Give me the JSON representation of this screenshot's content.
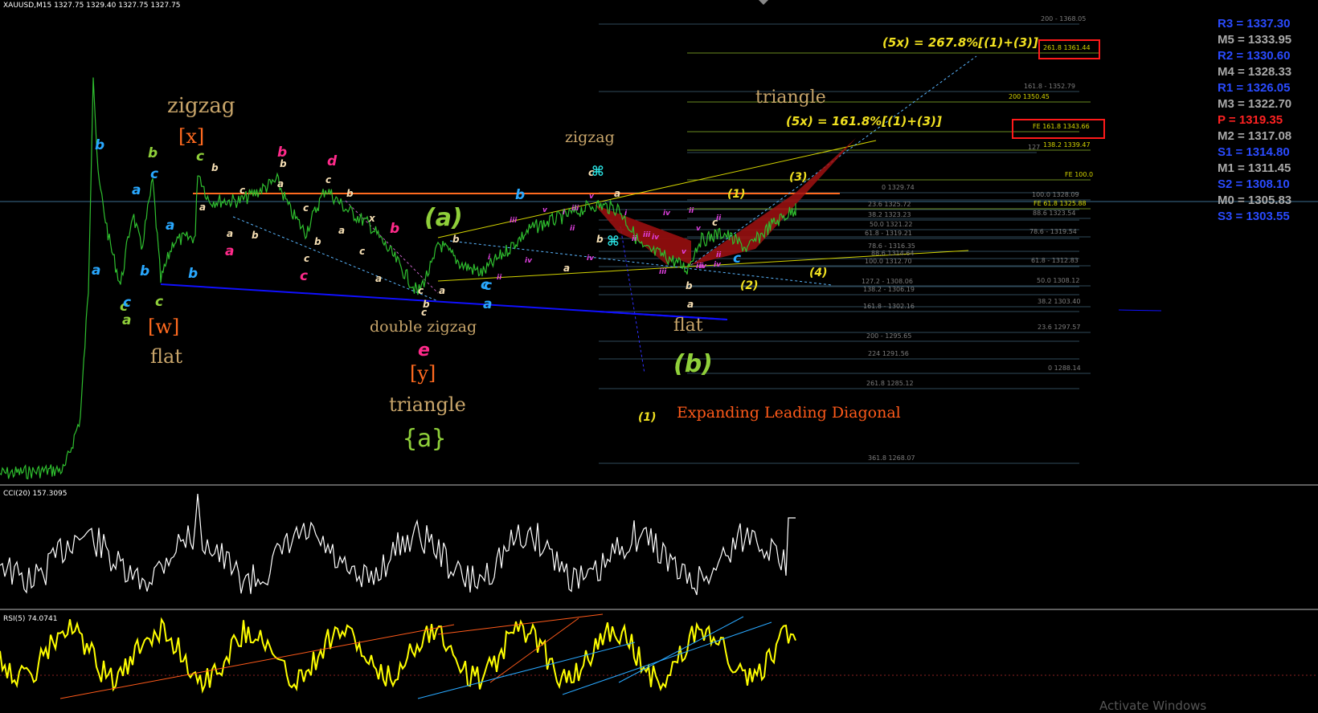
{
  "header": {
    "title": "XAUUSD,M15  1327.75 1329.40 1327.75 1327.75",
    "cci_label": "CCI(20) 157.3095",
    "rsi_label": "RSI(5) 74.0741"
  },
  "pivots": [
    {
      "label": "R3 = 1337.30",
      "color": "#2a4bff"
    },
    {
      "label": "M5 = 1333.95",
      "color": "#a9a9a9"
    },
    {
      "label": "R2 = 1330.60",
      "color": "#2a4bff"
    },
    {
      "label": "M4 = 1328.33",
      "color": "#a9a9a9"
    },
    {
      "label": "R1 = 1326.05",
      "color": "#2a4bff"
    },
    {
      "label": "M3 = 1322.70",
      "color": "#a9a9a9"
    },
    {
      "label": "P  = 1319.35",
      "color": "#ff2222"
    },
    {
      "label": "M2 = 1317.08",
      "color": "#a9a9a9"
    },
    {
      "label": "S1 = 1314.80",
      "color": "#2a4bff"
    },
    {
      "label": "M1 = 1311.45",
      "color": "#a9a9a9"
    },
    {
      "label": "S2 = 1308.10",
      "color": "#2a4bff"
    },
    {
      "label": "M0 = 1305.83",
      "color": "#a9a9a9"
    },
    {
      "label": "S3 = 1303.55",
      "color": "#2a4bff"
    }
  ],
  "fib_levels": [
    {
      "label": "200 - 1368.05",
      "color": "#7d7d7d"
    },
    {
      "label": "261.8 1361.44",
      "color": "#d4d400"
    },
    {
      "label": "161.8 - 1352.79",
      "color": "#7d7d7d"
    },
    {
      "label": "200 1350.45",
      "color": "#d4d400"
    },
    {
      "label": "FE 161.8 1343.66",
      "color": "#d4d400"
    },
    {
      "label": "127",
      "color": "#7d7d7d"
    },
    {
      "label": "138.2 1339.47",
      "color": "#d4d400"
    },
    {
      "label": "FE 100.0",
      "color": "#d4d400"
    },
    {
      "label": "0 1329.74",
      "color": "#7d7d7d"
    },
    {
      "label": "100.0 1328.09",
      "color": "#7d7d7d"
    },
    {
      "label": "23.6 1325.72",
      "color": "#7d7d7d"
    },
    {
      "label": "FE 61.8 1325.88",
      "color": "#d4d400"
    },
    {
      "label": "38.2 1323.23",
      "color": "#7d7d7d"
    },
    {
      "label": "88.6 1323.54",
      "color": "#7d7d7d"
    },
    {
      "label": "50.0 1321.22",
      "color": "#7d7d7d"
    },
    {
      "label": "61.8 - 1319.21",
      "color": "#7d7d7d"
    },
    {
      "label": "78.6 - 1319.54",
      "color": "#7d7d7d"
    },
    {
      "label": "78.6 - 1316.35",
      "color": "#7d7d7d"
    },
    {
      "label": "88.6 1314.64",
      "color": "#7d7d7d"
    },
    {
      "label": "100.0 1312.70",
      "color": "#7d7d7d"
    },
    {
      "label": "61.8 - 1312.83",
      "color": "#7d7d7d"
    },
    {
      "label": "127.2 - 1308.06",
      "color": "#7d7d7d"
    },
    {
      "label": "138.2 - 1306.19",
      "color": "#7d7d7d"
    },
    {
      "label": "50.0 1308.12",
      "color": "#7d7d7d"
    },
    {
      "label": "161.8 - 1302.16",
      "color": "#7d7d7d"
    },
    {
      "label": "38.2 1303.40",
      "color": "#7d7d7d"
    },
    {
      "label": "200 - 1295.65",
      "color": "#7d7d7d"
    },
    {
      "label": "23.6 1297.57",
      "color": "#7d7d7d"
    },
    {
      "label": "224 1291.56",
      "color": "#7d7d7d"
    },
    {
      "label": "0 1288.14",
      "color": "#7d7d7d"
    },
    {
      "label": "261.8 1285.12",
      "color": "#7d7d7d"
    },
    {
      "label": "361.8 1268.07",
      "color": "#7d7d7d"
    }
  ],
  "annotations": [
    {
      "text": "zigzag",
      "color": "#c8a56a"
    },
    {
      "text": "[x]",
      "color": "#ff6a1f"
    },
    {
      "text": "[w]",
      "color": "#ff6a1f"
    },
    {
      "text": "flat",
      "color": "#c8a56a"
    },
    {
      "text": "(a)",
      "color": "#8fcf3a"
    },
    {
      "text": "double zigzag",
      "color": "#c8a56a"
    },
    {
      "text": "e",
      "color": "#ff2a8a"
    },
    {
      "text": "[y]",
      "color": "#ff6a1f"
    },
    {
      "text": "triangle",
      "color": "#c8a56a"
    },
    {
      "text": "{a}",
      "color": "#8fcf3a"
    },
    {
      "text": "zigzag",
      "color": "#c8a56a"
    },
    {
      "text": "triangle",
      "color": "#c8a56a"
    },
    {
      "text": "(5x) = 267.8%[(1)+(3)]",
      "color": "#f0e020"
    },
    {
      "text": "(5x) = 161.8%[(1)+(3)]",
      "color": "#f0e020"
    },
    {
      "text": "flat",
      "color": "#c8a56a"
    },
    {
      "text": "(b)",
      "color": "#8fcf3a"
    },
    {
      "text": "Expanding Leading Diagonal",
      "color": "#ff5a1a"
    },
    {
      "text": "(1)",
      "color": "#f0e020"
    },
    {
      "text": "(2)",
      "color": "#f0e020"
    },
    {
      "text": "(3)",
      "color": "#f0e020"
    },
    {
      "text": "(4)",
      "color": "#f0e020"
    },
    {
      "text": "(1)",
      "color": "#f0e020"
    }
  ],
  "wave_labels": [
    {
      "text": "b",
      "color": "#29a8ff"
    },
    {
      "text": "b",
      "color": "#8fcf3a"
    },
    {
      "text": "c",
      "color": "#29a8ff"
    },
    {
      "text": "a",
      "color": "#29a8ff"
    },
    {
      "text": "a",
      "color": "#29a8ff"
    },
    {
      "text": "b",
      "color": "#29a8ff"
    },
    {
      "text": "c",
      "color": "#8fcf3a"
    },
    {
      "text": "a",
      "color": "#29a8ff"
    },
    {
      "text": "b",
      "color": "#29a8ff"
    },
    {
      "text": "c",
      "color": "#29a8ff"
    },
    {
      "text": "a",
      "color": "#8fcf3a"
    },
    {
      "text": "c",
      "color": "#8fcf3a"
    },
    {
      "text": "c",
      "color": "#8fcf3a"
    },
    {
      "text": "b",
      "color": "#f5deb3"
    },
    {
      "text": "a",
      "color": "#f5deb3"
    },
    {
      "text": "a",
      "color": "#f5deb3"
    },
    {
      "text": "c",
      "color": "#f5deb3"
    },
    {
      "text": "b",
      "color": "#f5deb3"
    },
    {
      "text": "a",
      "color": "#ff2a8a"
    },
    {
      "text": "b",
      "color": "#ff2a8a"
    },
    {
      "text": "b",
      "color": "#f5deb3"
    },
    {
      "text": "a",
      "color": "#f5deb3"
    },
    {
      "text": "c",
      "color": "#f5deb3"
    },
    {
      "text": "b",
      "color": "#f5deb3"
    },
    {
      "text": "c",
      "color": "#f5deb3"
    },
    {
      "text": "c",
      "color": "#ff2a8a"
    },
    {
      "text": "d",
      "color": "#ff2a8a"
    },
    {
      "text": "c",
      "color": "#f5deb3"
    },
    {
      "text": "b",
      "color": "#f5deb3"
    },
    {
      "text": "a",
      "color": "#f5deb3"
    },
    {
      "text": "x",
      "color": "#f5deb3"
    },
    {
      "text": "c",
      "color": "#f5deb3"
    },
    {
      "text": "a",
      "color": "#f5deb3"
    },
    {
      "text": "b",
      "color": "#ff2a8a"
    },
    {
      "text": "c",
      "color": "#f5deb3"
    },
    {
      "text": "a",
      "color": "#f5deb3"
    },
    {
      "text": "b",
      "color": "#f5deb3"
    },
    {
      "text": "c",
      "color": "#29a8ff"
    },
    {
      "text": "a",
      "color": "#29a8ff"
    },
    {
      "text": "b",
      "color": "#29a8ff"
    },
    {
      "text": "a",
      "color": "#f5deb3"
    },
    {
      "text": "b",
      "color": "#f5deb3"
    },
    {
      "text": "c",
      "color": "#f5deb3"
    },
    {
      "text": "a",
      "color": "#f5deb3"
    },
    {
      "text": "b",
      "color": "#f5deb3"
    },
    {
      "text": "c",
      "color": "#f5deb3"
    },
    {
      "text": "c",
      "color": "#29a8ff"
    },
    {
      "text": "i",
      "color": "#e040e0"
    },
    {
      "text": "ii",
      "color": "#e040e0"
    },
    {
      "text": "iii",
      "color": "#e040e0"
    },
    {
      "text": "iv",
      "color": "#e040e0"
    },
    {
      "text": "v",
      "color": "#e040e0"
    },
    {
      "text": "i",
      "color": "#e040e0"
    },
    {
      "text": "ii",
      "color": "#e040e0"
    },
    {
      "text": "iii",
      "color": "#e040e0"
    },
    {
      "text": "iv",
      "color": "#e040e0"
    },
    {
      "text": "v",
      "color": "#e040e0"
    },
    {
      "text": "i",
      "color": "#e040e0"
    },
    {
      "text": "ii",
      "color": "#e040e0"
    },
    {
      "text": "iii",
      "color": "#e040e0"
    },
    {
      "text": "iv",
      "color": "#e040e0"
    },
    {
      "text": "v",
      "color": "#e040e0"
    },
    {
      "text": "ii",
      "color": "#e040e0"
    },
    {
      "text": "iii",
      "color": "#e040e0"
    },
    {
      "text": "iv",
      "color": "#e040e0"
    },
    {
      "text": "v",
      "color": "#e040e0"
    },
    {
      "text": "ii",
      "color": "#e040e0"
    },
    {
      "text": "iv",
      "color": "#e040e0"
    },
    {
      "text": "iii",
      "color": "#e040e0"
    },
    {
      "text": "iv",
      "color": "#e040e0"
    },
    {
      "text": "ii",
      "color": "#e040e0"
    },
    {
      "text": "c",
      "color": "#f5deb3"
    },
    {
      "text": "c",
      "color": "#29a8ff"
    },
    {
      "text": "b",
      "color": "#f5deb3"
    },
    {
      "text": "a",
      "color": "#f5deb3"
    },
    {
      "text": "⌘",
      "color": "#29e0e0"
    },
    {
      "text": "⌘",
      "color": "#29e0e0"
    }
  ],
  "chart_data": {
    "type": "line",
    "title": "XAUUSD,M15",
    "price_range": [
      1268.07,
      1368.05
    ],
    "series": [
      {
        "name": "XAUUSD,M15",
        "values": [
          1327.75,
          1329.4,
          1327.75,
          1327.75
        ]
      },
      {
        "name": "CCI(20)",
        "values": [
          157.3095
        ]
      },
      {
        "name": "RSI(5)",
        "values": [
          74.0741
        ]
      }
    ],
    "grid": false
  },
  "watermark": "Activate Windows"
}
